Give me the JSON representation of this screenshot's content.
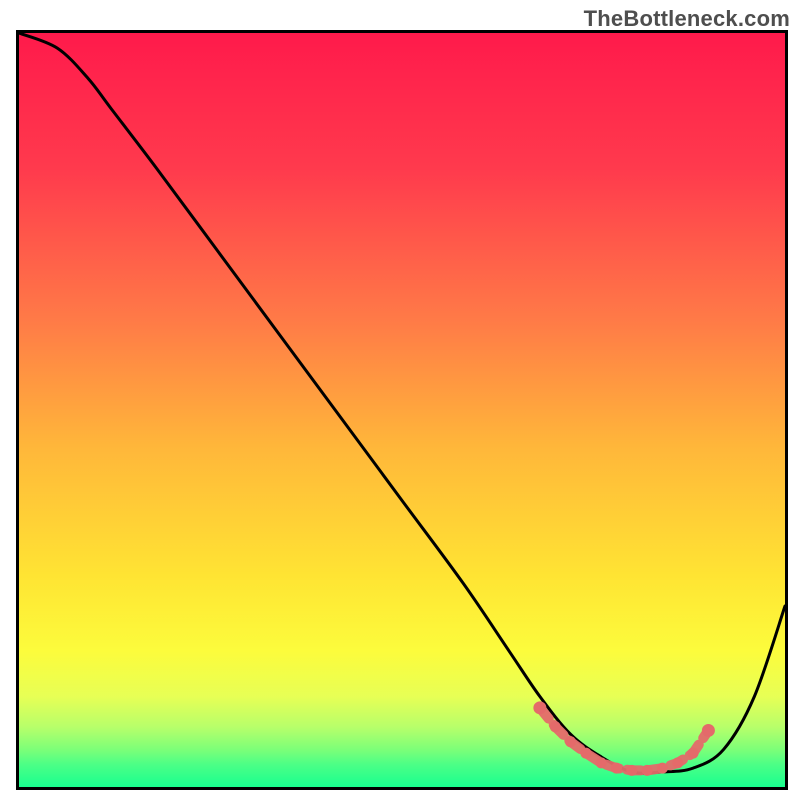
{
  "watermark": "TheBottleneck.com",
  "chart_data": {
    "type": "line",
    "title": "",
    "xlabel": "",
    "ylabel": "",
    "xlim": [
      0,
      100
    ],
    "ylim": [
      0,
      100
    ],
    "grid": false,
    "legend": false,
    "gradient_stops": [
      {
        "offset": 0,
        "color": "#ff1a4b"
      },
      {
        "offset": 18,
        "color": "#ff3a4d"
      },
      {
        "offset": 38,
        "color": "#ff7a47"
      },
      {
        "offset": 55,
        "color": "#ffb73a"
      },
      {
        "offset": 72,
        "color": "#ffe433"
      },
      {
        "offset": 82,
        "color": "#fcfc3c"
      },
      {
        "offset": 88,
        "color": "#e7ff55"
      },
      {
        "offset": 92,
        "color": "#b8ff6a"
      },
      {
        "offset": 95,
        "color": "#7dff78"
      },
      {
        "offset": 97,
        "color": "#4cff86"
      },
      {
        "offset": 100,
        "color": "#19ff8f"
      }
    ],
    "series": [
      {
        "name": "bottleneck-curve",
        "color": "#000000",
        "x": [
          0,
          5,
          9,
          12,
          18,
          26,
          34,
          42,
          50,
          58,
          64,
          68,
          72,
          76,
          80,
          84,
          88,
          92,
          96,
          100
        ],
        "values": [
          100,
          98,
          94,
          90,
          82,
          71,
          60,
          49,
          38,
          27,
          18,
          12,
          7,
          4,
          2,
          2,
          2.5,
          5,
          12,
          24
        ]
      }
    ],
    "markers": {
      "name": "optimal-range",
      "color": "#e46a6a",
      "x": [
        68,
        70,
        72,
        74,
        76,
        78,
        80,
        82,
        84,
        86,
        88,
        90
      ],
      "values": [
        10.5,
        8,
        6,
        4.5,
        3.2,
        2.5,
        2.2,
        2.2,
        2.5,
        3.2,
        4.5,
        7.5
      ]
    }
  }
}
